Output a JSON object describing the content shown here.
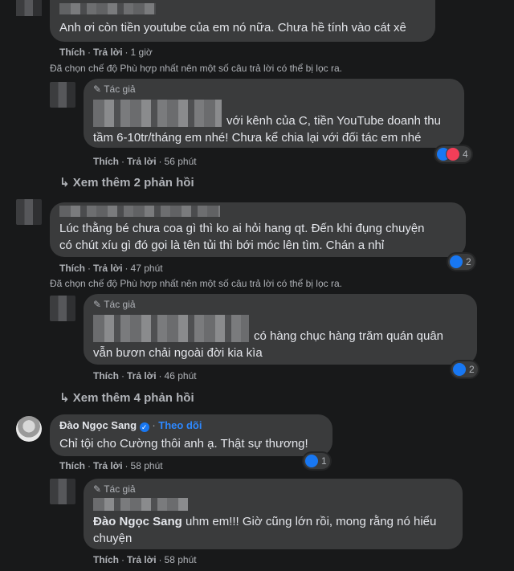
{
  "comments": [
    {
      "text": "Anh ơi còn tiền youtube của em nó nữa. Chưa hề tính vào cát xê",
      "like": "Thích",
      "reply": "Trả lời",
      "time": "1 giờ",
      "filter_note": "Đã chọn chế độ Phù hợp nhất nên một số câu trả lời có thể bị lọc ra."
    },
    {
      "author_tag": "Tác giả",
      "text_line1": "với kênh của C, tiền YouTube doanh thu",
      "text_line2": "tầm 6-10tr/tháng em nhé! Chưa kể chia lại với đối tác em nhé",
      "like": "Thích",
      "reply": "Trả lời",
      "time": "56 phút",
      "reaction_count": "4"
    },
    {
      "more_replies": "Xem thêm 2 phản hồi"
    },
    {
      "text_line1": "Lúc thằng bé chưa coa gì thì ko ai hỏi hang qt. Đến khi đụng chuyện",
      "text_line2": "có chút xíu gì đó gọi là tên tủi thì bới móc lên tìm. Chán a nhỉ",
      "like": "Thích",
      "reply": "Trả lời",
      "time": "47 phút",
      "reaction_count": "2",
      "filter_note": "Đã chọn chế độ Phù hợp nhất nên một số câu trả lời có thể bị lọc ra."
    },
    {
      "author_tag": "Tác giả",
      "text_line1": "có hàng chục hàng trăm quán quân",
      "text_line2": "vẫn bươn chải ngoài đời kia kìa",
      "like": "Thích",
      "reply": "Trả lời",
      "time": "46 phút",
      "reaction_count": "2"
    },
    {
      "more_replies": "Xem thêm 4 phản hồi"
    },
    {
      "author": "Đào Ngọc Sang",
      "follow": "Theo dõi",
      "text": "Chỉ tội cho Cường thôi anh ạ. Thật sự thương!",
      "like": "Thích",
      "reply": "Trả lời",
      "time": "58 phút",
      "reaction_count": "1"
    },
    {
      "author_tag": "Tác giả",
      "mention": "Đào Ngọc Sang",
      "text_line1": " uhm em!!! Giờ cũng lớn rồi, mong rằng nó hiểu",
      "text_line2": "chuyện",
      "like": "Thích",
      "reply": "Trả lời",
      "time": "58 phút"
    }
  ],
  "colors": {
    "background": "#18191a",
    "bubble": "#3a3b3c",
    "link": "#2d88ff",
    "like_blue": "#1877f2",
    "heart_red": "#f33e58"
  }
}
